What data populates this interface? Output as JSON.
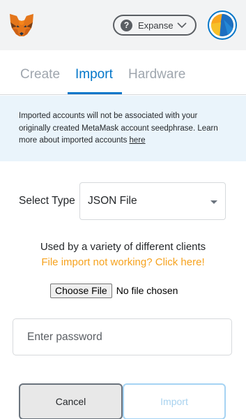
{
  "header": {
    "network": {
      "label": "Expanse",
      "icon": "question-icon"
    },
    "colors": {
      "accent": "#0376c9",
      "warning_link": "#f6a21e"
    }
  },
  "tabs": [
    {
      "label": "Create",
      "active": false
    },
    {
      "label": "Import",
      "active": true
    },
    {
      "label": "Hardware",
      "active": false
    }
  ],
  "notice": {
    "text": "Imported accounts will not be associated with your originally created MetaMask account seedphrase. Learn more about imported accounts ",
    "link": "here"
  },
  "import_form": {
    "select_label": "Select Type",
    "select_value": "JSON File",
    "used_by_text": "Used by a variety of different clients",
    "help_link": "File import not working? Click here!",
    "choose_file_label": "Choose File",
    "no_file_text": "No file chosen",
    "password_placeholder": "Enter password",
    "cancel_label": "Cancel",
    "import_label": "Import"
  }
}
